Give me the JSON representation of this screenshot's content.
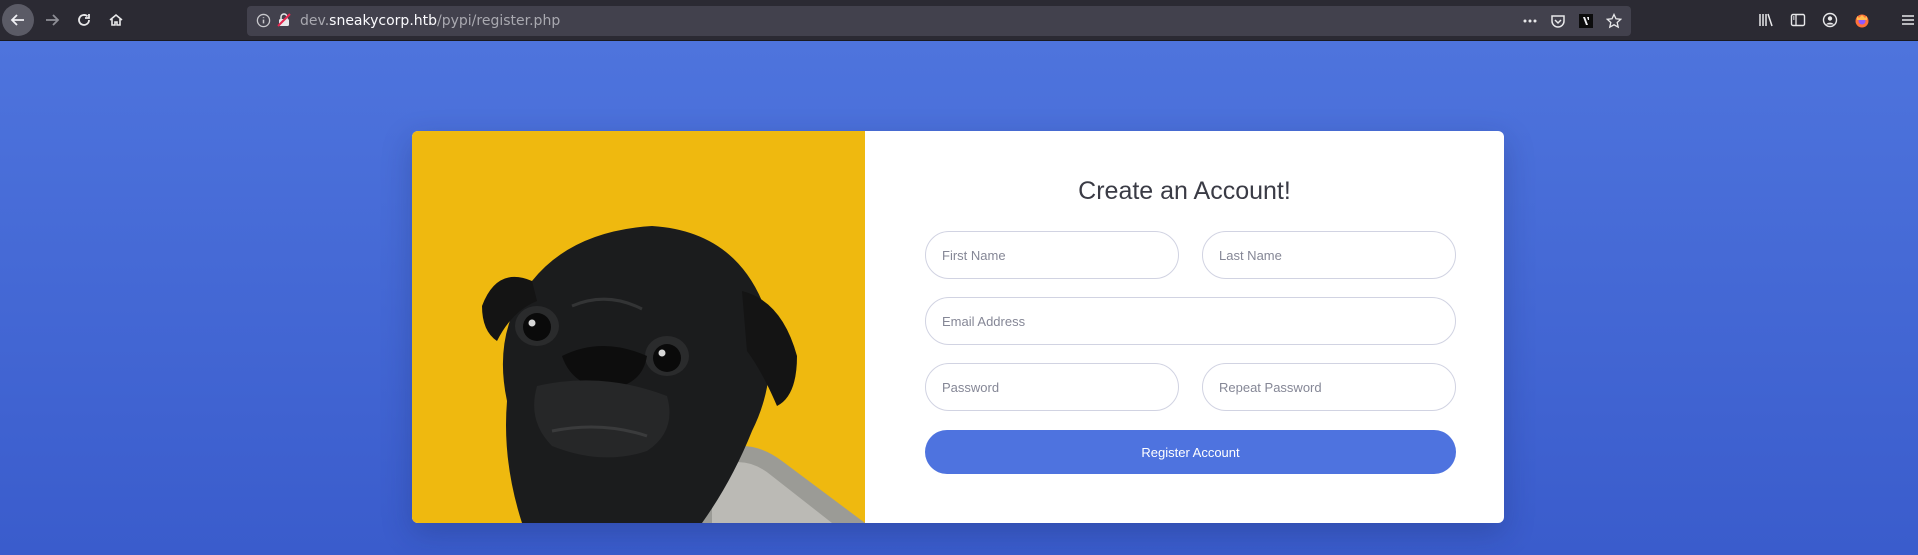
{
  "browser": {
    "url_host_prefix": "dev.",
    "url_host": "sneakycorp.htb",
    "url_path": "/pypi/register.php"
  },
  "form": {
    "heading": "Create an Account!",
    "first_name_placeholder": "First Name",
    "last_name_placeholder": "Last Name",
    "email_placeholder": "Email Address",
    "password_placeholder": "Password",
    "repeat_password_placeholder": "Repeat Password",
    "register_label": "Register Account"
  },
  "colors": {
    "page_background": "#4e73df",
    "image_background": "#efb90f",
    "button": "#4e73df"
  },
  "icons": [
    "back-arrow-icon",
    "forward-arrow-icon",
    "reload-icon",
    "home-icon",
    "info-icon",
    "insecure-lock-icon",
    "more-icon",
    "pocket-icon",
    "extension-icon",
    "bookmark-star-icon",
    "library-icon",
    "sidebar-icon",
    "account-icon",
    "firefox-icon",
    "menu-icon",
    "pug-photo"
  ]
}
